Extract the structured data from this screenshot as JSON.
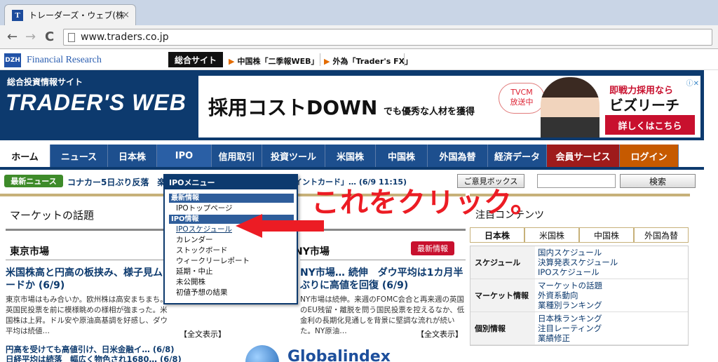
{
  "browser": {
    "tab_title": "トレーダーズ・ウェブ(株",
    "favicon_text": "T",
    "tab_close": "×",
    "back": "←",
    "forward": "→",
    "reload": "C",
    "url": "www.traders.co.jp"
  },
  "topbar": {
    "dzh_text": "DZH",
    "fr_text": "Financial Research",
    "sogo": "総合サイト",
    "link1": "中国株「二季報WEB」",
    "link2": "外為「Trader's FX」",
    "arrow_glyph": "▶"
  },
  "header": {
    "site_tag": "総合投資情報サイト",
    "logo": "TRADER'S WEB"
  },
  "banner": {
    "main": "採用コストDOWN",
    "sub": "でも優秀な人材を獲得",
    "tvcm_line1": "TVCM",
    "tvcm_line2": "放送中",
    "bz_top": "即戦力採用なら",
    "bz_name": "ビズリーチ",
    "bz_btn": "詳しくはこちら",
    "ad_mark": "ⓘ✕"
  },
  "nav": {
    "items": [
      {
        "label": "ホーム",
        "bg": "#ffffff",
        "fg": "#111111"
      },
      {
        "label": "ニュース",
        "bg": "#1d4f8e",
        "fg": "#ffffff"
      },
      {
        "label": "日本株",
        "bg": "#1d4f8e",
        "fg": "#ffffff"
      },
      {
        "label": "IPO",
        "bg": "#2a5fa5",
        "fg": "#ffffff"
      },
      {
        "label": "信用取引",
        "bg": "#1d4f8e",
        "fg": "#ffffff"
      },
      {
        "label": "投資ツール",
        "bg": "#1d4f8e",
        "fg": "#ffffff"
      },
      {
        "label": "米国株",
        "bg": "#1d4f8e",
        "fg": "#ffffff"
      },
      {
        "label": "中国株",
        "bg": "#1d4f8e",
        "fg": "#ffffff"
      },
      {
        "label": "外国為替",
        "bg": "#1d4f8e",
        "fg": "#ffffff"
      },
      {
        "label": "経済データ",
        "bg": "#1d4f8e",
        "fg": "#ffffff"
      },
      {
        "label": "会員サービス",
        "bg": "#9e1b1b",
        "fg": "#ffffff"
      },
      {
        "label": "ログイン",
        "bg": "#c65a00",
        "fg": "#ffffff"
      }
    ]
  },
  "newsbar": {
    "badge": "最新ニュース",
    "headline": "コナカー5日ぶり反落　楽",
    "mid": "イントカード」… (6/9 11:15)",
    "opinion": "ご意見ボックス",
    "search_btn": "検索",
    "search_placeholder": ""
  },
  "market": {
    "title": "マーケットの話題",
    "tokyo": "東京市場",
    "ny": "NY市場",
    "new_info": "最新情報",
    "left_head": "米国株高と円高の板挟み、様子見ムードか (6/9)",
    "left_body": "東京市場はもみ合いか。欧州株は高安まちまち。英国民投票を前に模様眺めの様相が強まった。米国株は上昇。ドル安や原油高基調を好感し、ダウ平均は続値…",
    "right_head": "NY市場… 続伸　ダウ平均は1カ月半ぶりに高値を回復 (6/9)",
    "right_body": "NY市場は続伸。来週のFOMC会合と再来週の英国のEU残留・離脱を問う国民投票を控えるなか、低金利の長期化見通しを背景に堅調な流れが続いた。NY原油…",
    "fulltext_left": "【全文表示】",
    "fulltext_right": "【全文表示】",
    "sub1": "円高を受けても高値引け、日米金融イ… (6/8)",
    "sub2": "日経平均は続落　幅広く物色され1680… (6/8)",
    "globalindex": "Globalindex"
  },
  "right": {
    "attention": "注目コンテンツ",
    "tabs": [
      "日本株",
      "米国株",
      "中国株",
      "外国為替"
    ],
    "rows": [
      {
        "label": "スケジュール",
        "values": [
          "国内スケジュール",
          "決算発表スケジュール",
          "IPOスケジュール"
        ]
      },
      {
        "label": "マーケット情報",
        "values": [
          "マーケットの話題",
          "外資系動向",
          "業種別ランキング"
        ]
      },
      {
        "label": "個別情報",
        "values": [
          "日本株ランキング",
          "注目レーティング",
          "業績修正"
        ]
      }
    ]
  },
  "dropdown": {
    "title": "IPOメニュー",
    "sec1": "最新情報",
    "sec1_items": [
      "IPOトップページ"
    ],
    "sec2": "IPO情報",
    "sec2_items": [
      "IPOスケジュール",
      "カレンダー",
      "ストックボード",
      "ウィークリーレポート",
      "延期・中止",
      "未公開株",
      "初値予想の結果"
    ]
  },
  "annotation": {
    "text": "これをクリック。",
    "color": "#ec1c24"
  }
}
